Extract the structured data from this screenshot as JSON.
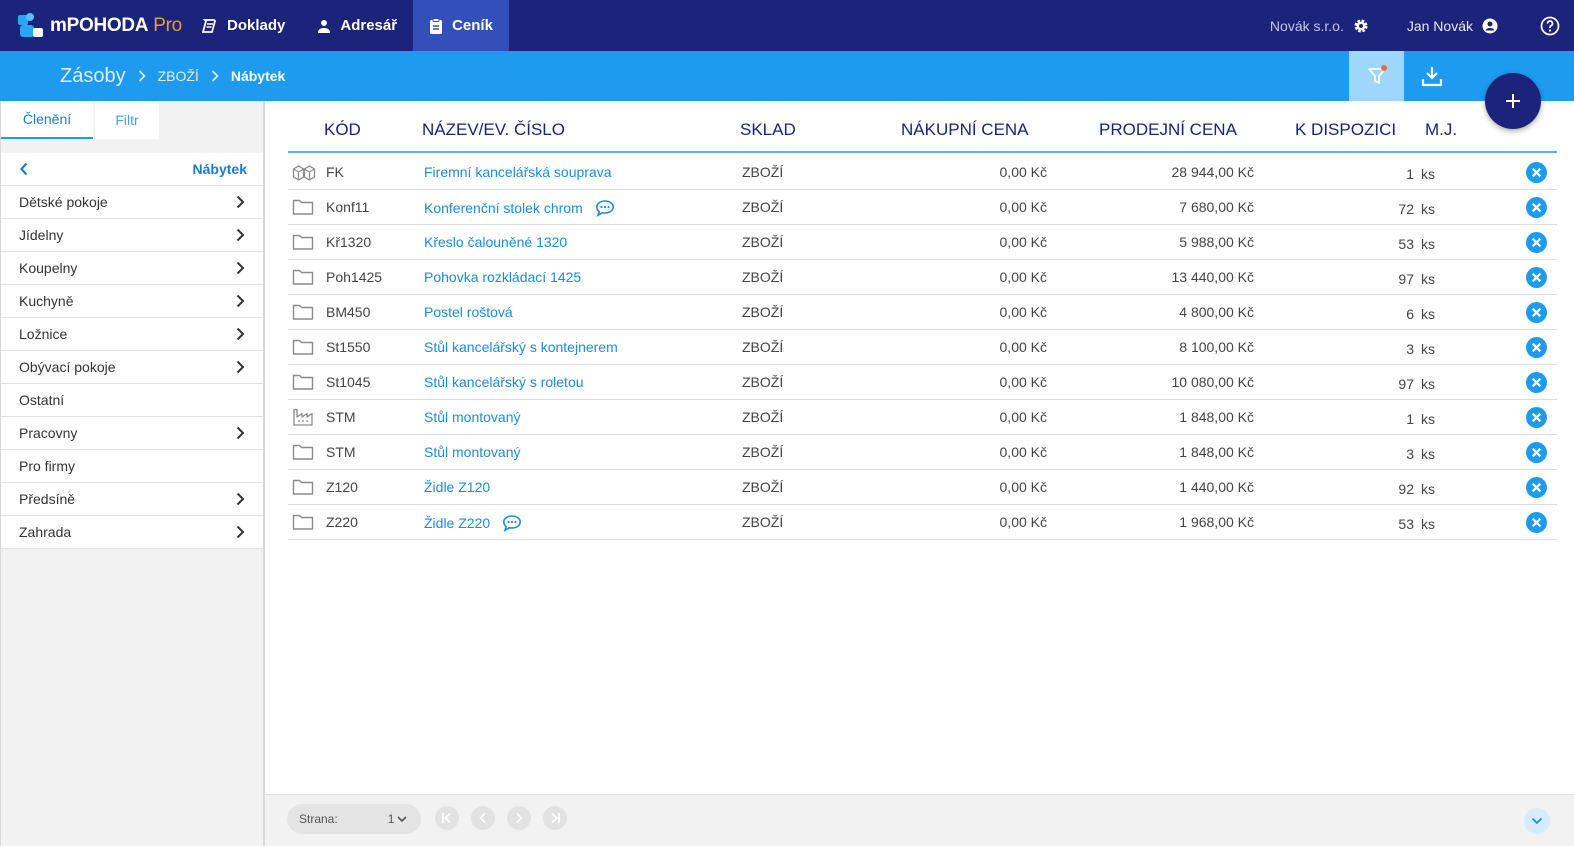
{
  "app": {
    "name": "mPOHODA",
    "edition": "Pro"
  },
  "nav": {
    "tabs": [
      {
        "label": "Doklady",
        "icon": "documents-icon"
      },
      {
        "label": "Adresář",
        "icon": "person-icon"
      },
      {
        "label": "Ceník",
        "icon": "clipboard-icon",
        "active": true
      }
    ],
    "company": "Novák s.r.o.",
    "user": "Jan Novák"
  },
  "breadcrumb": {
    "root": "Zásoby",
    "mid": "ZBOŽÍ",
    "current": "Nábytek"
  },
  "sidebar": {
    "tabs": [
      "Členění",
      "Filtr"
    ],
    "current_category": "Nábytek",
    "categories": [
      {
        "label": "Dětské pokoje",
        "has_children": true
      },
      {
        "label": "Jídelny",
        "has_children": true
      },
      {
        "label": "Koupelny",
        "has_children": true
      },
      {
        "label": "Kuchyně",
        "has_children": true
      },
      {
        "label": "Ložnice",
        "has_children": true
      },
      {
        "label": "Obývací pokoje",
        "has_children": true
      },
      {
        "label": "Ostatní",
        "has_children": false
      },
      {
        "label": "Pracovny",
        "has_children": true
      },
      {
        "label": "Pro firmy",
        "has_children": false
      },
      {
        "label": "Předsíně",
        "has_children": true
      },
      {
        "label": "Zahrada",
        "has_children": true
      }
    ]
  },
  "table": {
    "headers": {
      "code": "KÓD",
      "name": "NÁZEV/EV. ČÍSLO",
      "store": "SKLAD",
      "buy": "NÁKUPNÍ CENA",
      "sell": "PRODEJNÍ CENA",
      "avail": "K DISPOZICI",
      "unit": "M.J."
    },
    "rows": [
      {
        "icon": "boxes-icon",
        "code": "FK",
        "name": "Firemní kancelářská souprava",
        "note": false,
        "store": "ZBOŽÍ",
        "buy": "0,00 Kč",
        "sell": "28 944,00 Kč",
        "qty": "1",
        "unit": "ks"
      },
      {
        "icon": "folder-icon",
        "code": "Konf11",
        "name": "Konferenční stolek chrom",
        "note": true,
        "store": "ZBOŽÍ",
        "buy": "0,00 Kč",
        "sell": "7 680,00 Kč",
        "qty": "72",
        "unit": "ks"
      },
      {
        "icon": "folder-icon",
        "code": "Kř1320",
        "name": "Křeslo čalouněné 1320",
        "note": false,
        "store": "ZBOŽÍ",
        "buy": "0,00 Kč",
        "sell": "5 988,00 Kč",
        "qty": "53",
        "unit": "ks"
      },
      {
        "icon": "folder-icon",
        "code": "Poh1425",
        "name": "Pohovka rozkládací 1425",
        "note": false,
        "store": "ZBOŽÍ",
        "buy": "0,00 Kč",
        "sell": "13 440,00 Kč",
        "qty": "97",
        "unit": "ks"
      },
      {
        "icon": "folder-icon",
        "code": "BM450",
        "name": "Postel roštová",
        "note": false,
        "store": "ZBOŽÍ",
        "buy": "0,00 Kč",
        "sell": "4 800,00 Kč",
        "qty": "6",
        "unit": "ks"
      },
      {
        "icon": "folder-icon",
        "code": "St1550",
        "name": "Stůl kancelářský s kontejnerem",
        "note": false,
        "store": "ZBOŽÍ",
        "buy": "0,00 Kč",
        "sell": "8 100,00 Kč",
        "qty": "3",
        "unit": "ks"
      },
      {
        "icon": "folder-icon",
        "code": "St1045",
        "name": "Stůl kancelářský s roletou",
        "note": false,
        "store": "ZBOŽÍ",
        "buy": "0,00 Kč",
        "sell": "10 080,00 Kč",
        "qty": "97",
        "unit": "ks"
      },
      {
        "icon": "factory-icon",
        "code": "STM",
        "name": "Stůl montovaný",
        "note": false,
        "store": "ZBOŽÍ",
        "buy": "0,00 Kč",
        "sell": "1 848,00 Kč",
        "qty": "1",
        "unit": "ks"
      },
      {
        "icon": "folder-icon",
        "code": "STM",
        "name": "Stůl montovaný",
        "note": false,
        "store": "ZBOŽÍ",
        "buy": "0,00 Kč",
        "sell": "1 848,00 Kč",
        "qty": "3",
        "unit": "ks"
      },
      {
        "icon": "folder-icon",
        "code": "Z120",
        "name": "Židle Z120",
        "note": false,
        "store": "ZBOŽÍ",
        "buy": "0,00 Kč",
        "sell": "1 440,00 Kč",
        "qty": "92",
        "unit": "ks"
      },
      {
        "icon": "folder-icon",
        "code": "Z220",
        "name": "Židle Z220",
        "note": true,
        "store": "ZBOŽÍ",
        "buy": "0,00 Kč",
        "sell": "1 968,00 Kč",
        "qty": "53",
        "unit": "ks"
      }
    ]
  },
  "pager": {
    "label": "Strana:",
    "page": "1"
  },
  "colors": {
    "nav": "#1b237a",
    "accent": "#1e9bef",
    "link": "#1e8ae0",
    "badge": "#f06a3c"
  }
}
